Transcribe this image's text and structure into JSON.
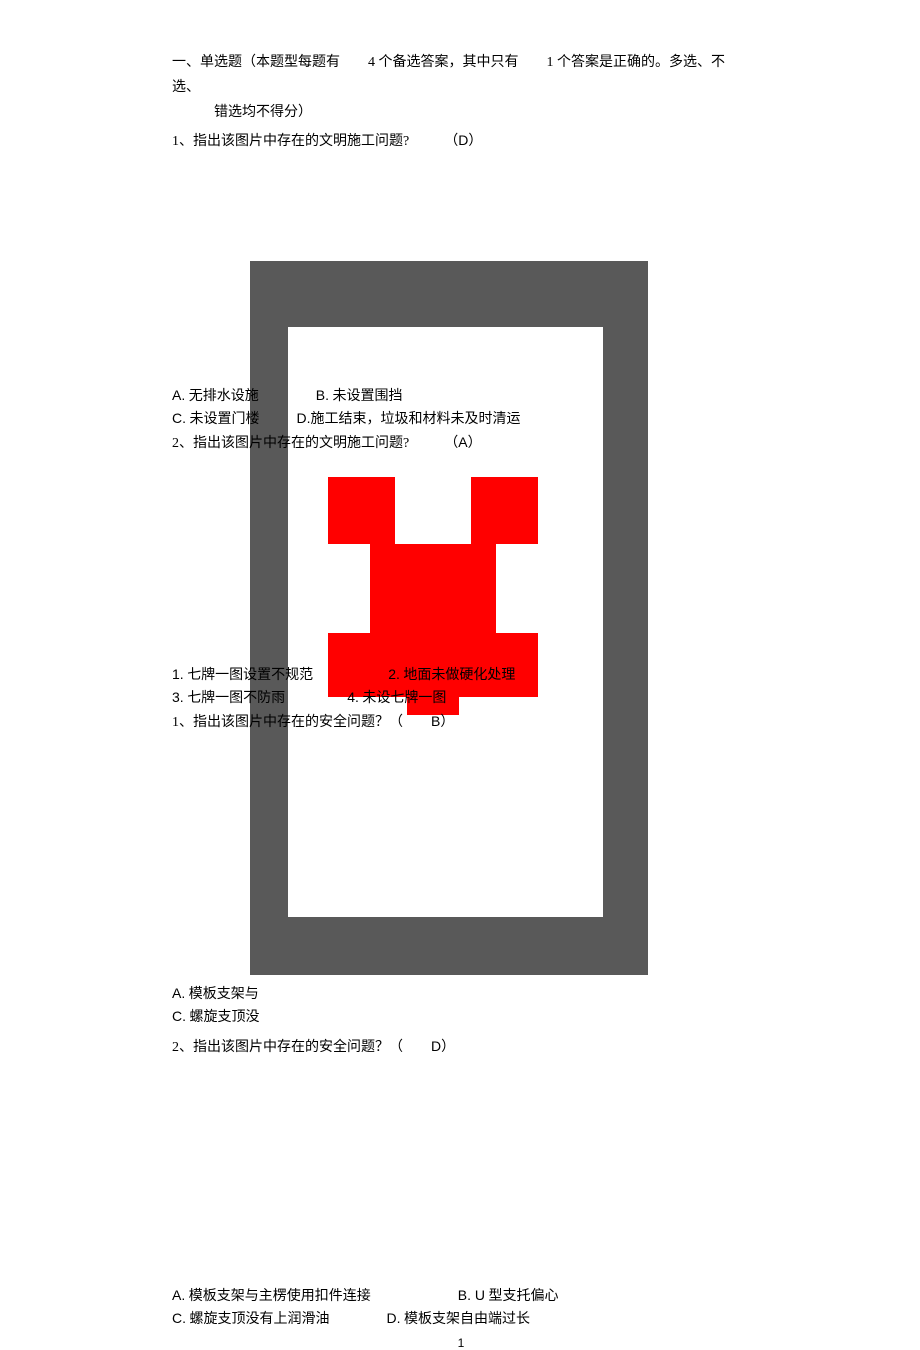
{
  "heading": {
    "line1": "一、单选题（本题型每题有　　4 个备选答案，其中只有　　1 个答案是正确的。多选、不选、",
    "line2": "错选均不得分）"
  },
  "q1": {
    "text": "1、指出该图片中存在的文明施工问题?　　　（",
    "ans": "D",
    "close": "）",
    "optA_label": "A.",
    "optA_text": "无排水设施",
    "optB_label": "B.",
    "optB_text": "未设置围挡",
    "optC_label": "C.",
    "optC_text": "未设置门楼",
    "optD_label": "D.",
    "optD_text": "施工结束，垃圾和材料未及时清运"
  },
  "q2": {
    "text": "2、指出该图片中存在的文明施工问题?　　　（",
    "ans": "A",
    "close": "）",
    "opt1_label": "1.",
    "opt1_text": "七牌一图设置不规范",
    "opt2_label": "2.",
    "opt2_text": "地面未做硬化处理",
    "opt3_label": "3.",
    "opt3_text": "七牌一图不防雨",
    "opt4_label": "4.",
    "opt4_text": "未设七牌一图"
  },
  "q3": {
    "text": "1、指出该图片中存在的安全问题？（　　",
    "ans": "B",
    "close": "）",
    "optA_label": "A.",
    "optA_text": "模板支架与",
    "optC_label": "C.",
    "optC_text": "螺旋支顶没"
  },
  "q4": {
    "text": "2、指出该图片中存在的安全问题？（　　",
    "ans": "D",
    "close": "）",
    "optA_label": "A.",
    "optA_text": "模板支架与主楞使用扣件连接",
    "optB_label": "B. U",
    "optB_text": "型支托偏心",
    "optC_label": "C.",
    "optC_text": "螺旋支顶没有上润滑油",
    "optD_label": "D.",
    "optD_text": "模板支架自由端过长"
  },
  "page_num": "1"
}
